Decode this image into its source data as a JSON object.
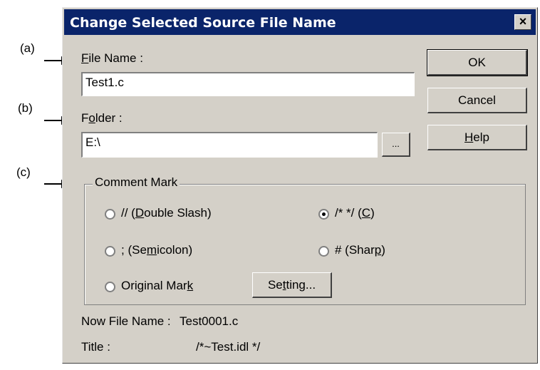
{
  "callouts": {
    "a": "(a)",
    "b": "(b)",
    "c": "(c)"
  },
  "dialog": {
    "title": "Change Selected Source File Name",
    "close": "×",
    "file_name_label": {
      "pre": "",
      "accel": "F",
      "post": "ile Name :"
    },
    "file_name_value": "Test1.c",
    "folder_label": {
      "pre": "F",
      "accel": "o",
      "post": "lder :"
    },
    "folder_value": "E:\\",
    "browse_label": "...",
    "ok_label": "OK",
    "cancel_label": "Cancel",
    "help_label": {
      "pre": "",
      "accel": "H",
      "post": "elp"
    },
    "comment_group_label": "Comment Mark",
    "radios": {
      "double_slash": {
        "pre": "// (",
        "accel": "D",
        "post": "ouble Slash)",
        "selected": false
      },
      "c_style": {
        "pre": "/*  */ (",
        "accel": "C",
        "post": ")",
        "selected": true
      },
      "semicolon": {
        "pre": "; (Se",
        "accel": "m",
        "post": "icolon)",
        "selected": false
      },
      "sharp": {
        "pre": "# (Shar",
        "accel": "p",
        "post": ")",
        "selected": false
      },
      "original": {
        "pre": "Original Mar",
        "accel": "k",
        "post": "",
        "selected": false
      }
    },
    "setting_label": {
      "pre": "Se",
      "accel": "t",
      "post": "ting..."
    },
    "now_file_label": "Now File Name :",
    "now_file_value": "Test0001.c",
    "title_label": "Title :",
    "title_value": "/*~Test.idl */"
  }
}
